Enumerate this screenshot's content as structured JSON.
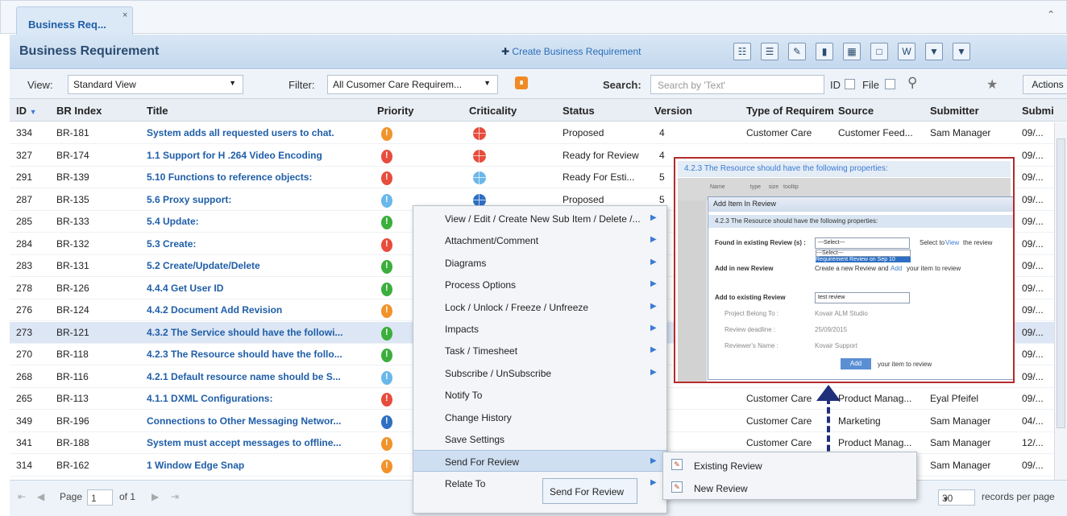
{
  "tab": {
    "label": "Business Req...",
    "close": "×"
  },
  "titlebar": {
    "title": "Business Requirement",
    "create": "Create Business Requirement"
  },
  "filterbar": {
    "view_label": "View:",
    "view_value": "Standard View",
    "filter_label": "Filter:",
    "filter_value": "All Cusomer Care Requirem...",
    "search_label": "Search:",
    "search_placeholder": "Search by 'Text'",
    "id_label": "ID",
    "file_label": "File",
    "actions": "Actions"
  },
  "columns": {
    "id": "ID",
    "br_index": "BR Index",
    "title": "Title",
    "priority": "Priority",
    "criticality": "Criticality",
    "status": "Status",
    "version": "Version",
    "type": "Type of Requirem",
    "source": "Source",
    "submitter": "Submitter",
    "submit": "Submi"
  },
  "rows": [
    {
      "id": "334",
      "br": "BR-181",
      "title": "System adds all requested users to chat.",
      "pri": "#f0932b",
      "crit": "#e74c3c",
      "status": "Proposed",
      "version": "4",
      "type": "Customer Care",
      "source": "Customer Feed...",
      "submitter": "Sam Manager",
      "date": "09/..."
    },
    {
      "id": "327",
      "br": "BR-174",
      "title": "1.1 Support for H .264 Video Encoding",
      "pri": "#e74c3c",
      "crit": "#e74c3c",
      "status": "Ready for Review",
      "version": "4",
      "type": "",
      "source": "",
      "submitter": "",
      "date": "09/..."
    },
    {
      "id": "291",
      "br": "BR-139",
      "title": "5.10 Functions to reference objects:",
      "pri": "#e74c3c",
      "crit": "#6ab7ea",
      "status": "Ready For Esti...",
      "version": "5",
      "type": "",
      "source": "",
      "submitter": "",
      "date": "09/..."
    },
    {
      "id": "287",
      "br": "BR-135",
      "title": "5.6 Proxy support:",
      "pri": "#6ab7ea",
      "crit": "#2d6fc4",
      "status": "Proposed",
      "version": "5",
      "type": "",
      "source": "",
      "submitter": "",
      "date": "09/..."
    },
    {
      "id": "285",
      "br": "BR-133",
      "title": "5.4 Update:",
      "pri": "#3cae3c",
      "crit": "",
      "status": "",
      "version": "",
      "type": "",
      "source": "",
      "submitter": "",
      "date": "09/..."
    },
    {
      "id": "284",
      "br": "BR-132",
      "title": "5.3 Create:",
      "pri": "#e74c3c",
      "crit": "",
      "status": "",
      "version": "",
      "type": "",
      "source": "",
      "submitter": "",
      "date": "09/..."
    },
    {
      "id": "283",
      "br": "BR-131",
      "title": "5.2 Create/Update/Delete",
      "pri": "#3cae3c",
      "crit": "",
      "status": "",
      "version": "",
      "type": "",
      "source": "",
      "submitter": "",
      "date": "09/..."
    },
    {
      "id": "278",
      "br": "BR-126",
      "title": "4.4.4 Get User ID",
      "pri": "#3cae3c",
      "crit": "",
      "status": "",
      "version": "",
      "type": "",
      "source": "",
      "submitter": "",
      "date": "09/..."
    },
    {
      "id": "276",
      "br": "BR-124",
      "title": "4.4.2 Document Add Revision",
      "pri": "#f0932b",
      "crit": "",
      "status": "",
      "version": "",
      "type": "",
      "source": "",
      "submitter": "",
      "date": "09/..."
    },
    {
      "id": "273",
      "br": "BR-121",
      "title": "4.3.2 The Service should have the followi...",
      "pri": "#3cae3c",
      "crit": "",
      "status": "",
      "version": "",
      "type": "",
      "source": "",
      "submitter": "",
      "date": "09/..."
    },
    {
      "id": "270",
      "br": "BR-118",
      "title": "4.2.3 The Resource should have the follo...",
      "pri": "#3cae3c",
      "crit": "",
      "status": "",
      "version": "",
      "type": "",
      "source": "",
      "submitter": "",
      "date": "09/..."
    },
    {
      "id": "268",
      "br": "BR-116",
      "title": "4.2.1 Default resource name should be S...",
      "pri": "#6ab7ea",
      "crit": "",
      "status": "",
      "version": "",
      "type": "",
      "source": "",
      "submitter": "",
      "date": "09/..."
    },
    {
      "id": "265",
      "br": "BR-113",
      "title": "4.1.1 DXML Configurations:",
      "pri": "#e74c3c",
      "crit": "",
      "status": "",
      "version": "",
      "type": "Customer Care",
      "source": "Product Manag...",
      "submitter": "Eyal Pfeifel",
      "date": "09/..."
    },
    {
      "id": "349",
      "br": "BR-196",
      "title": "Connections to Other Messaging Networ...",
      "pri": "#2d6fc4",
      "crit": "",
      "status": "",
      "version": "",
      "type": "Customer Care",
      "source": "Marketing",
      "submitter": "Sam Manager",
      "date": "04/..."
    },
    {
      "id": "341",
      "br": "BR-188",
      "title": "System must accept messages to offline...",
      "pri": "#f0932b",
      "crit": "",
      "status": "",
      "version": "",
      "type": "Customer Care",
      "source": "Product Manag...",
      "submitter": "Sam Manager",
      "date": "12/..."
    },
    {
      "id": "314",
      "br": "BR-162",
      "title": "1 Window Edge Snap",
      "pri": "#f0932b",
      "crit": "",
      "status": "",
      "version": "",
      "type": "",
      "source": "",
      "submitter": "Sam Manager",
      "date": "09/..."
    }
  ],
  "selected_row_id": "273",
  "context_menu": [
    {
      "label": "View / Edit / Create New Sub Item / Delete /...",
      "arrow": true
    },
    {
      "label": "Attachment/Comment",
      "arrow": true
    },
    {
      "label": "Diagrams",
      "arrow": true
    },
    {
      "label": "Process Options",
      "arrow": true
    },
    {
      "label": "Lock / Unlock / Freeze / Unfreeze",
      "arrow": true
    },
    {
      "label": "Impacts",
      "arrow": true
    },
    {
      "label": "Task / Timesheet",
      "arrow": true
    },
    {
      "label": "Subscribe / UnSubscribe",
      "arrow": true
    },
    {
      "label": "Notify To",
      "arrow": false
    },
    {
      "label": "Change History",
      "arrow": false
    },
    {
      "label": "Save Settings",
      "arrow": false
    },
    {
      "label": "Send For Review",
      "arrow": true
    },
    {
      "label": "Relate To",
      "arrow": true
    }
  ],
  "highlighted_menu_item": "Send For Review",
  "submenu": [
    {
      "label": "Existing Review"
    },
    {
      "label": "New Review"
    }
  ],
  "tooltip": "Send For Review",
  "preview": {
    "heading": "4.2.3 The Resource should have the following properties:",
    "dialog_title": "Add Item In Review",
    "dialog_sub": "4.2.3 The Resource should have the following properties:",
    "found_label": "Found in existing Review (s)  :",
    "select_value": "---Select---",
    "select_to": "Select to",
    "view": "View",
    "the_review": "the review",
    "opt1": "---Select---",
    "opt2": "Requirement Review on Sep 10",
    "add_new_label": "Add in new Review",
    "create_new": "Create a new Review and",
    "add_link": "Add",
    "your_item": "your item to review",
    "add_existing_label": "Add to existing Review",
    "existing_value": "test review",
    "project_label": "Project Belong To :",
    "project_value": "Kovair ALM Studio",
    "deadline_label": "Review deadline :",
    "deadline_value": "25/09/2015",
    "reviewer_label": "Reviewer's Name :",
    "reviewer_value": "Kovair Support",
    "add_button": "Add",
    "add_button_tail": "your item to review"
  },
  "pager": {
    "page_label": "Page",
    "page_value": "1",
    "of_label": "of 1",
    "per_page": "30",
    "per_page_label": "records per page"
  }
}
